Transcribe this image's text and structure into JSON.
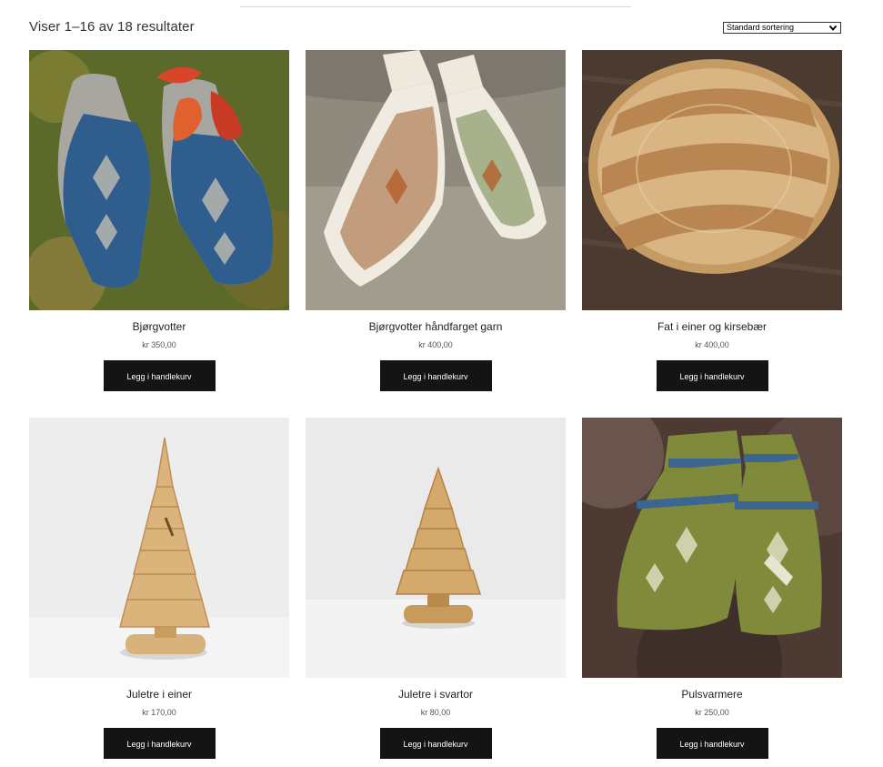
{
  "shop": {
    "result_count": "Viser 1–16 av 18 resultater",
    "sort": {
      "selected": "Standard sortering"
    }
  },
  "products": [
    {
      "title": "Bjørgvotter",
      "price": "kr 350,00",
      "button": "Legg i handlekurv",
      "image": "blue-mittens-on-moss"
    },
    {
      "title": "Bjørgvotter håndfarget garn",
      "price": "kr 400,00",
      "button": "Legg i handlekurv",
      "image": "multicolor-mittens-on-sofa"
    },
    {
      "title": "Fat i einer og kirsebær",
      "price": "kr 400,00",
      "button": "Legg i handlekurv",
      "image": "striped-wooden-plate"
    },
    {
      "title": "Juletre i einer",
      "price": "kr 170,00",
      "button": "Legg i handlekurv",
      "image": "juniper-wooden-tree"
    },
    {
      "title": "Juletre i svartor",
      "price": "kr 80,00",
      "button": "Legg i handlekurv",
      "image": "alder-wooden-tree"
    },
    {
      "title": "Pulsvarmere",
      "price": "kr 250,00",
      "button": "Legg i handlekurv",
      "image": "green-wrist-warmers-on-fur"
    }
  ],
  "colors": {
    "button_bg": "#141414",
    "button_text": "#ffffff"
  }
}
